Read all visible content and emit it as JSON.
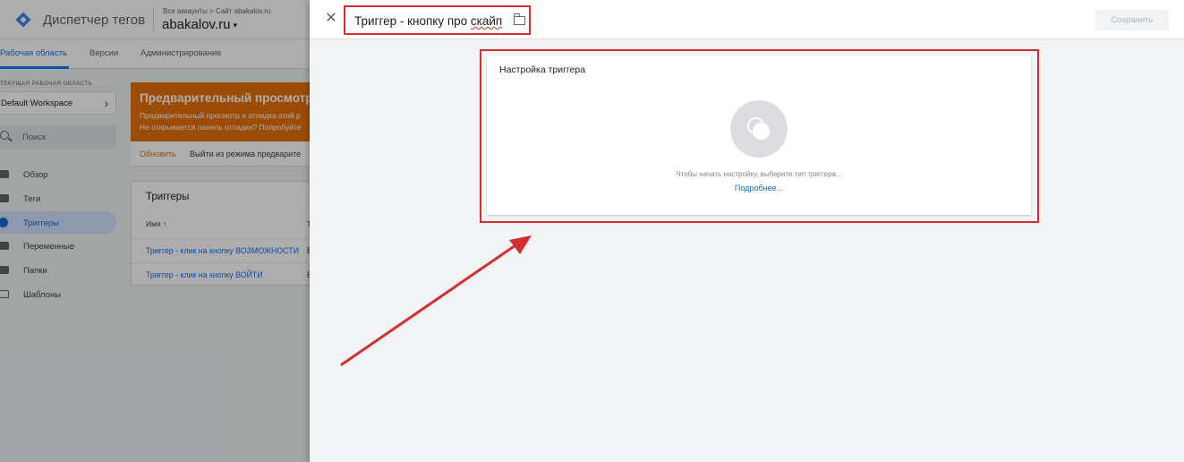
{
  "app": {
    "title": "Диспетчер тегов",
    "breadcrumb": "Все аккаунты > Сайт abakalov.ru",
    "account": "abakalov.ru",
    "account_caret": "▾"
  },
  "nav": {
    "tabs": [
      {
        "label": "Рабочая область",
        "active": true
      },
      {
        "label": "Версии"
      },
      {
        "label": "Администрирование"
      }
    ]
  },
  "sidebar": {
    "workspace_label": "ТЕКУЩАЯ РАБОЧАЯ ОБЛАСТЬ",
    "workspace_name": "Default Workspace",
    "search_placeholder": "Поиск",
    "items": [
      {
        "label": "Обзор",
        "icon": "overview-icon"
      },
      {
        "label": "Теги",
        "icon": "tag-icon"
      },
      {
        "label": "Триггеры",
        "icon": "trigger-icon",
        "active": true
      },
      {
        "label": "Переменные",
        "icon": "variables-icon"
      },
      {
        "label": "Папки",
        "icon": "folder-icon"
      },
      {
        "label": "Шаблоны",
        "icon": "template-icon"
      }
    ]
  },
  "preview_banner": {
    "heading": "Предварительный просмотр р",
    "line1": "Предварительный просмотр и отладка этой р",
    "line2": "Не открывается панель отладки? Попробуйте",
    "action_refresh": "Обновить",
    "action_exit": "Выйти из режима предварите"
  },
  "triggers_card": {
    "title": "Триггеры",
    "col_name": "Имя",
    "col_name_sort_icon": "↑",
    "col_type": "Т",
    "rows": [
      {
        "name": "Триггер - клик на кнопку ВОЗМОЖНОСТИ",
        "type": "В"
      },
      {
        "name": "Триггер - клик на кнопку ВОЙТИ",
        "type": "В"
      }
    ]
  },
  "editor": {
    "close": "✕",
    "trigger_name_prefix": "Триггер - кнопку про ",
    "trigger_name_misspelled": "скайп",
    "save_label": "Сохранить",
    "config_title": "Настройка триггера",
    "config_hint": "Чтобы начать настройку, выберите тип триггера...",
    "config_more": "Подробнее..."
  },
  "colors": {
    "accent": "#1a73e8",
    "annotation_red": "#d32f2f",
    "banner_orange": "#e8710a"
  }
}
